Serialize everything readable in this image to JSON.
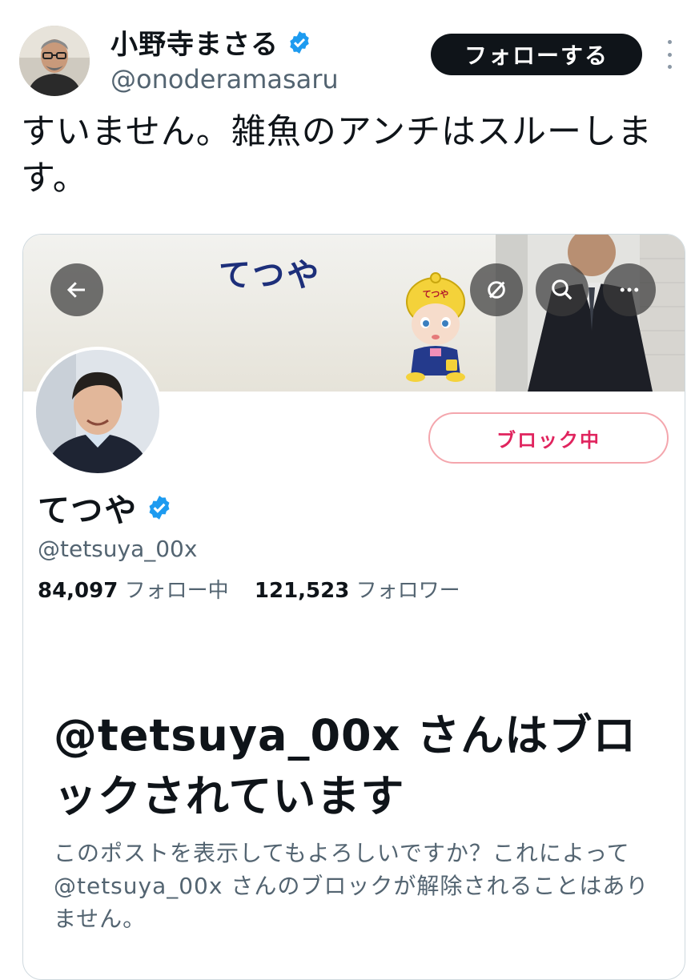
{
  "tweet": {
    "author_name": "小野寺まさる",
    "author_handle": "@onoderamasaru",
    "follow_label": "フォローする",
    "text": "すいません。雑魚のアンチはスルーします。"
  },
  "embedded": {
    "banner_title": "てつや",
    "baby_cap_text": "てつや",
    "profile_name": "てつや",
    "profile_handle": "@tetsuya_00x",
    "blocked_button": "ブロック中",
    "following_count": "84,097",
    "following_label": "フォロー中",
    "followers_count": "121,523",
    "followers_label": "フォロワー",
    "blocked_title": "@tetsuya_00x さんはブロックされています",
    "blocked_desc": "このポストを表示してもよろしいですか？これによって @tetsuya_00x さんのブロックが解除されることはありません。"
  },
  "colors": {
    "verified": "#1d9bf0",
    "follow_bg": "#0f1419",
    "blocked_red": "#e0245e",
    "secondary_text": "#536471"
  },
  "icons": [
    "verified-badge-icon",
    "more-icon",
    "back-arrow-icon",
    "hide-media-icon",
    "search-icon",
    "more-options-icon"
  ]
}
